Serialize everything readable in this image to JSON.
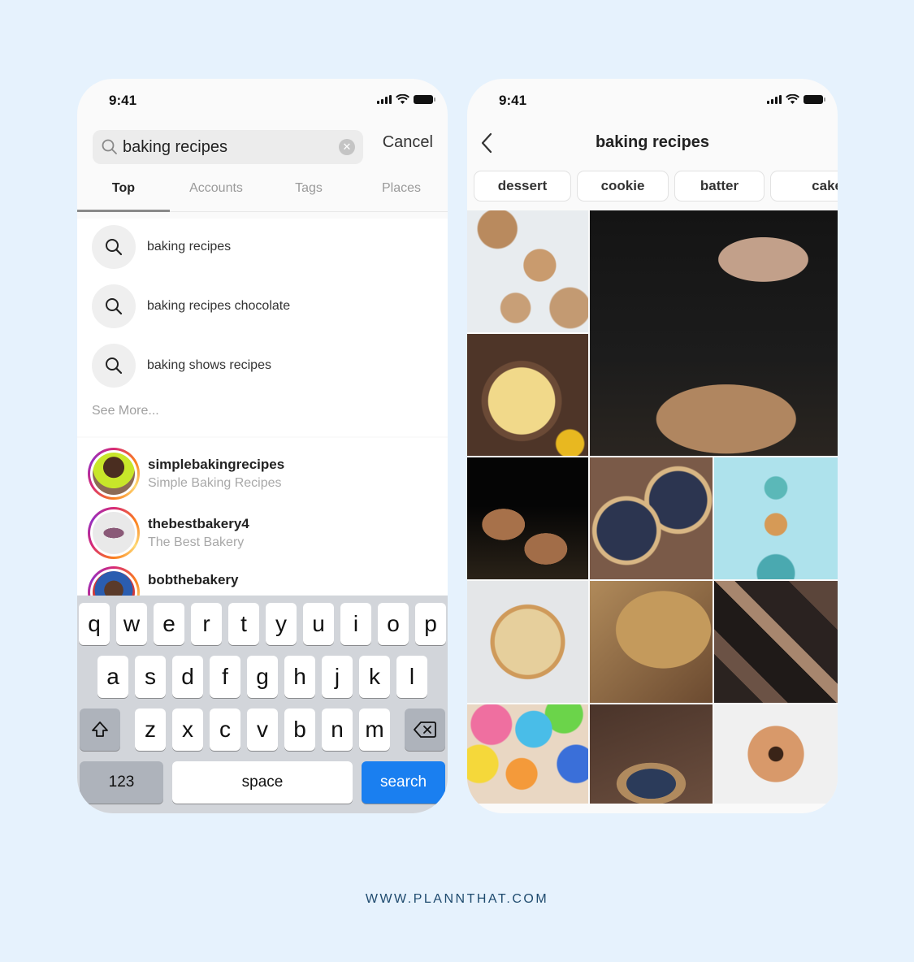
{
  "left_phone": {
    "status": {
      "time": "9:41"
    },
    "search": {
      "value": "baking recipes",
      "cancel_label": "Cancel"
    },
    "tabs": [
      {
        "label": "Top",
        "active": true
      },
      {
        "label": "Accounts",
        "active": false
      },
      {
        "label": "Tags",
        "active": false
      },
      {
        "label": "Places",
        "active": false
      }
    ],
    "suggestions": [
      {
        "label": "baking recipes",
        "icon": "search-icon"
      },
      {
        "label": "baking recipes chocolate",
        "icon": "search-icon"
      },
      {
        "label": "baking shows recipes",
        "icon": "search-icon"
      }
    ],
    "see_more_label": "See More...",
    "accounts": [
      {
        "username": "simplebakingrecipes",
        "name": "Simple Baking Recipes"
      },
      {
        "username": "thebestbakery4",
        "name": "The Best Bakery"
      },
      {
        "username": "bobthebakery",
        "name": ""
      }
    ],
    "keyboard": {
      "row1": [
        "q",
        "w",
        "e",
        "r",
        "t",
        "y",
        "u",
        "i",
        "o",
        "p"
      ],
      "row2": [
        "a",
        "s",
        "d",
        "f",
        "g",
        "h",
        "j",
        "k",
        "l"
      ],
      "row3": [
        "z",
        "x",
        "c",
        "v",
        "b",
        "n",
        "m"
      ],
      "numbers_label": "123",
      "space_label": "space",
      "search_label": "search",
      "shift_icon": "shift-icon",
      "delete_icon": "backspace-icon"
    }
  },
  "right_phone": {
    "status": {
      "time": "9:41"
    },
    "title": "baking recipes",
    "chips": [
      "dessert",
      "cookie",
      "batter",
      "cake"
    ],
    "grid": [
      {
        "label": "mini lattice pies on marble"
      },
      {
        "label": "dusting powdered sugar on apple tart"
      },
      {
        "label": "lattice pie on wood"
      },
      {
        "label": "muffins on dark background"
      },
      {
        "label": "blueberry lattice tarts"
      },
      {
        "label": "macaron on blue background"
      },
      {
        "label": "golden pie top view"
      },
      {
        "label": "crumble with spoon"
      },
      {
        "label": "chocolate pieces"
      },
      {
        "label": "colorful donuts"
      },
      {
        "label": "blueberry pie slice"
      },
      {
        "label": "glazed donut with bite"
      }
    ]
  },
  "footer": {
    "url": "WWW.PLANNTHAT.COM"
  },
  "colors": {
    "background": "#e6f2fd",
    "search_key": "#1a7ff0",
    "footer_text": "#1e4a6e"
  }
}
